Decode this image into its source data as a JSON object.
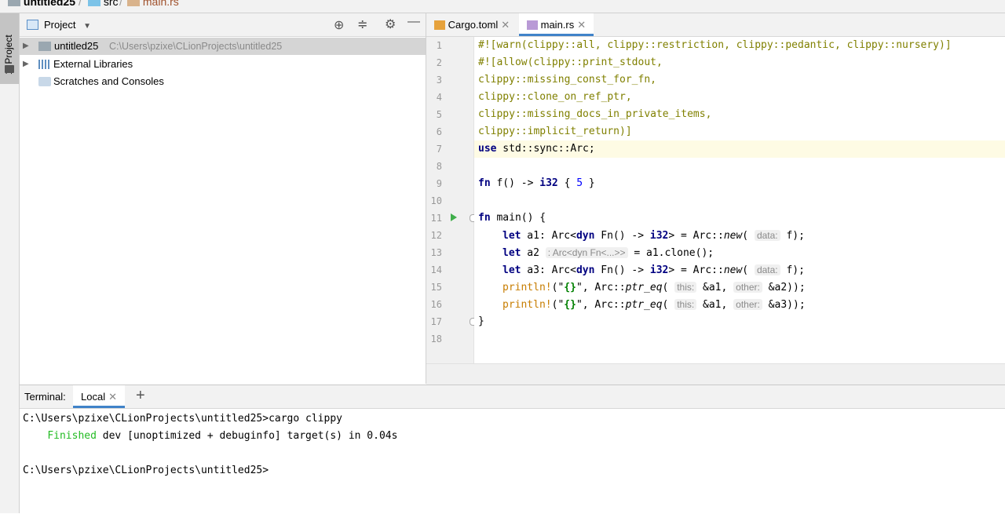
{
  "breadcrumb": {
    "project": "untitled25",
    "folder": "src",
    "file": "main.rs"
  },
  "side_stripe": {
    "project_tab": "1: Project"
  },
  "project_pane": {
    "title": "Project",
    "tree": [
      {
        "label": "untitled25",
        "path": "C:\\Users\\pzixe\\CLionProjects\\untitled25",
        "icon": "folder-icon"
      },
      {
        "label": "External Libraries",
        "icon": "libraries-icon"
      },
      {
        "label": "Scratches and Consoles",
        "icon": "scratches-icon"
      }
    ]
  },
  "editor": {
    "tabs": [
      {
        "label": "Cargo.toml",
        "icon": "toml-file-icon"
      },
      {
        "label": "main.rs",
        "icon": "rust-file-icon",
        "active": true
      }
    ],
    "line_numbers": [
      "1",
      "2",
      "3",
      "4",
      "5",
      "6",
      "7",
      "8",
      "9",
      "10",
      "11",
      "12",
      "13",
      "14",
      "15",
      "16",
      "17",
      "18"
    ],
    "current_line": 7,
    "code": {
      "l1": "#![warn(clippy::all, clippy::restriction, clippy::pedantic, clippy::nursery)]",
      "l2": "#![allow(clippy::print_stdout,",
      "l3": "clippy::missing_const_for_fn,",
      "l4": "clippy::clone_on_ref_ptr,",
      "l5": "clippy::missing_docs_in_private_items,",
      "l6": "clippy::implicit_return)]",
      "l7_kw": "use",
      "l7": " std::sync::Arc;",
      "l9_kw": "fn",
      "l9_a": " f() -> ",
      "l9_ty": "i32",
      "l9_b": " { ",
      "l9_num": "5",
      "l9_c": " }",
      "l11_kw": "fn",
      "l11": " main() {",
      "l12_kw": "let",
      "l12_a": " a1: Arc<",
      "l12_dyn": "dyn",
      "l12_b": " Fn() -> ",
      "l12_ty": "i32",
      "l12_c": "> = Arc::",
      "l12_new": "new",
      "l12_d": "(",
      "l12_hint": "data:",
      "l12_e": " f);",
      "l13_kw": "let",
      "l13_a": " a2",
      "l13_hint": ": Arc<dyn Fn<...>>",
      "l13_b": " = a1.clone();",
      "l14_kw": "let",
      "l14_a": " a3: Arc<",
      "l14_dyn": "dyn",
      "l14_b": " Fn() -> ",
      "l14_ty": "i32",
      "l14_c": "> = Arc::",
      "l14_new": "new",
      "l14_d": "(",
      "l14_hint": "data:",
      "l14_e": " f);",
      "l15_mac": "println!",
      "l15_a": "(\"",
      "l15_str": "{}",
      "l15_b": "\", Arc::",
      "l15_fn": "ptr_eq",
      "l15_c": "(",
      "l15_h1": "this:",
      "l15_d": " &a1, ",
      "l15_h2": "other:",
      "l15_e": " &a2));",
      "l16_mac": "println!",
      "l16_a": "(\"",
      "l16_str": "{}",
      "l16_b": "\", Arc::",
      "l16_fn": "ptr_eq",
      "l16_c": "(",
      "l16_h1": "this:",
      "l16_d": " &a1, ",
      "l16_h2": "other:",
      "l16_e": " &a3));",
      "l17": "}"
    }
  },
  "terminal": {
    "title": "Terminal:",
    "tab": "Local",
    "lines": {
      "prompt1": "C:\\Users\\pzixe\\CLionProjects\\untitled25>cargo clippy",
      "finished": "Finished",
      "finished_rest": " dev [unoptimized + debuginfo] target(s) in 0.04s",
      "prompt2": "C:\\Users\\pzixe\\CLionProjects\\untitled25>"
    }
  },
  "colors": {
    "accent": "#4083c9",
    "current_line": "#fefbe4",
    "finished": "#22bb22"
  }
}
